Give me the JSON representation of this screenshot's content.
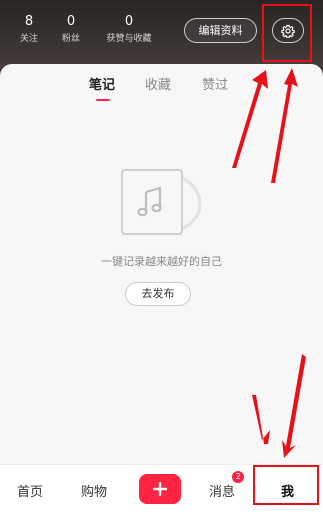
{
  "header": {
    "stats": [
      {
        "value": "8",
        "label": "关注"
      },
      {
        "value": "0",
        "label": "粉丝"
      },
      {
        "value": "0",
        "label": "获赞与收藏"
      }
    ],
    "edit_profile_label": "编辑资料",
    "settings_icon": "gear-icon"
  },
  "tabs": [
    {
      "label": "笔记",
      "active": true
    },
    {
      "label": "收藏",
      "active": false
    },
    {
      "label": "赞过",
      "active": false
    }
  ],
  "empty_state": {
    "illustration_icon": "music-note-icon",
    "message": "一键记录越来越好的自己",
    "publish_label": "去发布"
  },
  "bottom_nav": {
    "items": [
      {
        "label": "首页"
      },
      {
        "label": "购物"
      },
      {
        "label": "消息"
      },
      {
        "label": "我"
      }
    ],
    "plus_icon": "plus-icon",
    "messages_badge": "2"
  },
  "colors": {
    "accent": "#ff2442",
    "annotation": "#e5121a"
  }
}
